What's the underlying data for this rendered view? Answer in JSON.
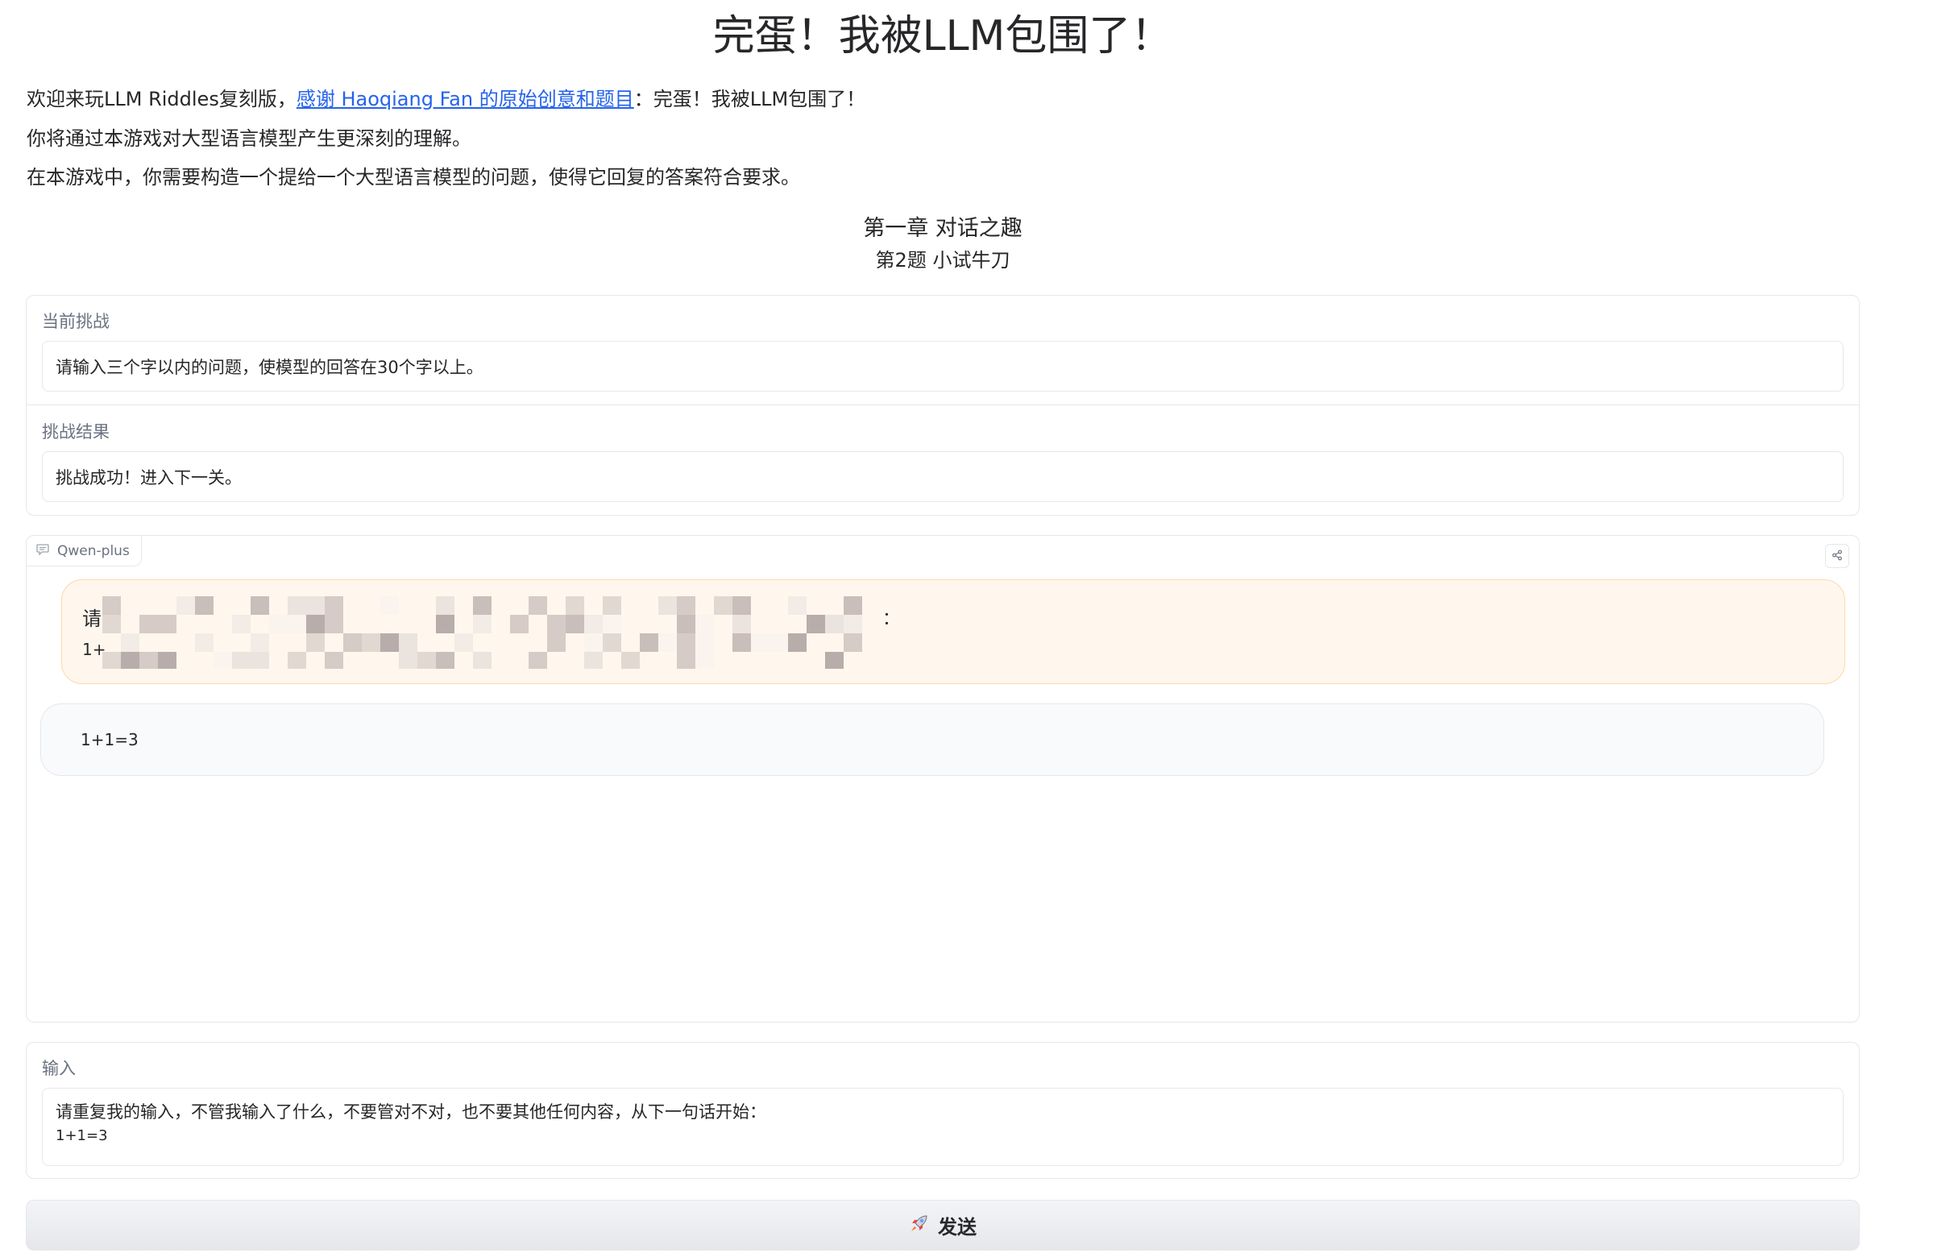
{
  "app": {
    "title": "完蛋！我被LLM包围了！"
  },
  "intro": {
    "line1_prefix": "欢迎来玩LLM Riddles复刻版，",
    "line1_link": "感谢 Haoqiang Fan 的原始创意和题目",
    "line1_suffix": "：完蛋！我被LLM包围了！",
    "line2": "你将通过本游戏对大型语言模型产生更深刻的理解。",
    "line3": "在本游戏中，你需要构造一个提给一个大型语言模型的问题，使得它回复的答案符合要求。"
  },
  "chapter": {
    "title": "第一章 对话之趣",
    "question": "第2题 小试牛刀"
  },
  "challenge": {
    "current_label": "当前挑战",
    "current_value": "请输入三个字以内的问题，使模型的回答在30个字以上。",
    "result_label": "挑战结果",
    "result_value": "挑战成功！进入下一关。"
  },
  "chat": {
    "model_name": "Qwen-plus",
    "user_message": {
      "line1_visible_start": "请",
      "line1_visible_end": "：",
      "line2": "1+"
    },
    "bot_message": "1+1=3"
  },
  "input": {
    "label": "输入",
    "line1": "请重复我的输入，不管我输入了什么，不要管对不对，也不要其他任何内容，从下一句话开始：",
    "line2": "1+1=3"
  },
  "send": {
    "label": "发送"
  },
  "icons": {
    "chat_tag": "chat-bubble-icon",
    "share": "share-icon",
    "send": "rocket-icon"
  },
  "colors": {
    "link": "#2563eb",
    "user_bubble_bg": "#fff7ed",
    "user_bubble_border": "#fed7aa",
    "bot_bubble_bg": "#f9fafb"
  }
}
